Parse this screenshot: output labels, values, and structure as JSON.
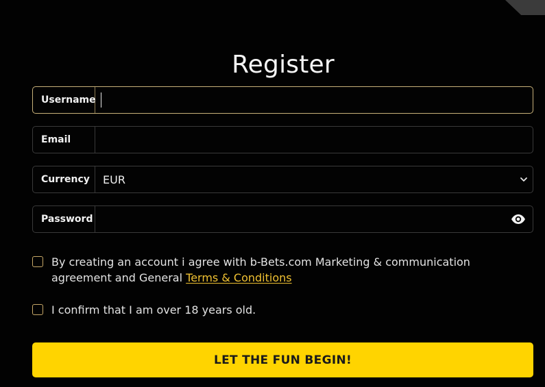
{
  "form": {
    "title": "Register",
    "fields": {
      "username": {
        "label": "Username",
        "value": ""
      },
      "email": {
        "label": "Email",
        "value": ""
      },
      "currency": {
        "label": "Currency",
        "value": "EUR"
      },
      "password": {
        "label": "Password",
        "value": ""
      }
    },
    "agreements": {
      "marketing": {
        "text": "By creating an account i agree with b-Bets.com Marketing & communication agreement and General",
        "link": "Terms & Conditions"
      },
      "age": {
        "text": "I confirm that I am over 18 years old."
      }
    },
    "submit_label": "LET THE FUN BEGIN!"
  },
  "colors": {
    "accent": "#ffd400",
    "link": "#f1c232",
    "checkbox_border": "#c7a868",
    "focus_border": "#c9b27a"
  },
  "icons": {
    "currency_dropdown": "chevron-down-icon",
    "password_toggle": "eye-icon"
  }
}
